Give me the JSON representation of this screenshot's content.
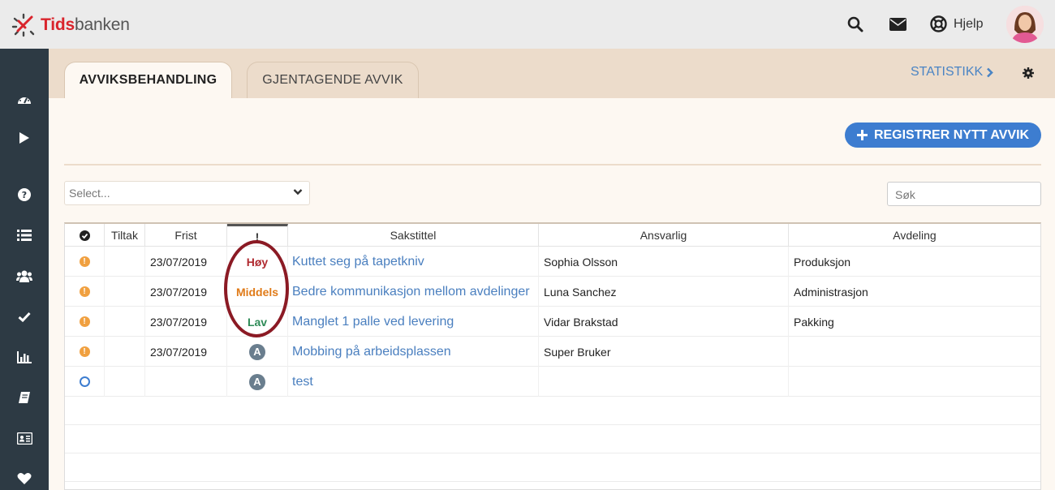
{
  "brand": {
    "name_part1": "Tids",
    "name_part2": "banken"
  },
  "header": {
    "help_label": "Hjelp",
    "icons": [
      "search-icon",
      "envelope-icon",
      "lifebuoy-icon"
    ]
  },
  "sidebar": {
    "icons": [
      "dashboard-icon",
      "play-icon",
      "question-icon",
      "list-icon",
      "users-icon",
      "check-icon",
      "bar-chart-icon",
      "book-icon",
      "id-card-icon",
      "heart-icon"
    ]
  },
  "tabs": [
    {
      "label": "AVVIKSBEHANDLING",
      "active": true
    },
    {
      "label": "GJENTAGENDE AVVIK",
      "active": false
    }
  ],
  "statistikk_label": "STATISTIKK",
  "register_button_label": "REGISTRER NYTT AVVIK",
  "filter": {
    "select_placeholder": "Select...",
    "search_placeholder": "Søk"
  },
  "table": {
    "columns": [
      "",
      "Tiltak",
      "Frist",
      "!",
      "Sakstittel",
      "Ansvarlig",
      "Avdeling"
    ],
    "rows": [
      {
        "status": "warning",
        "tiltak": "",
        "frist": "23/07/2019",
        "priority": "Høy",
        "priority_level": "hoy",
        "title": "Kuttet seg på tapetkniv",
        "ansvarlig": "Sophia Olsson",
        "avdeling": "Produksjon"
      },
      {
        "status": "warning",
        "tiltak": "",
        "frist": "23/07/2019",
        "priority": "Middels",
        "priority_level": "middels",
        "title": "Bedre kommunikasjon mellom avdelinger",
        "ansvarlig": "Luna Sanchez",
        "avdeling": "Administrasjon"
      },
      {
        "status": "warning",
        "tiltak": "",
        "frist": "23/07/2019",
        "priority": "Lav",
        "priority_level": "lav",
        "title": "Manglet 1 palle ved levering",
        "ansvarlig": "Vidar Brakstad",
        "avdeling": "Pakking"
      },
      {
        "status": "warning",
        "tiltak": "",
        "frist": "23/07/2019",
        "priority": "A",
        "priority_level": "badge",
        "title": "Mobbing på arbeidsplassen",
        "ansvarlig": "Super Bruker",
        "avdeling": ""
      },
      {
        "status": "open",
        "tiltak": "",
        "frist": "",
        "priority": "A",
        "priority_level": "badge",
        "title": "test",
        "ansvarlig": "",
        "avdeling": ""
      }
    ]
  },
  "colors": {
    "accent": "#3d7dd0",
    "sidebar": "#2d3a44",
    "tabbar": "#ecdccb",
    "highlight_oval": "#8b1a24"
  }
}
